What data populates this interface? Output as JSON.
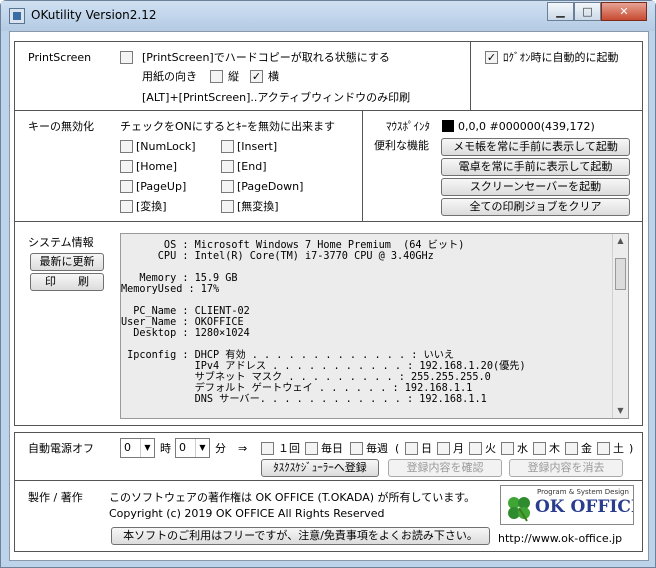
{
  "window": {
    "title": "OKutility Version2.12",
    "minimize": "▁",
    "maximize": "□",
    "close": "✕"
  },
  "print": {
    "group_label": "PrintScreen",
    "hardcopy_label": "[PrintScreen]でハードコピーが取れる状態にする",
    "paper_label": "用紙の向き",
    "portrait_label": "縦",
    "landscape_label": "横",
    "landscape_check": "✓",
    "alt_label": "[ALT]+[PrintScreen]..アクティブウィンドウのみ印刷",
    "logon_label": "ﾛｸﾞｵﾝ時に自動的に起動",
    "logon_check": "✓"
  },
  "keys": {
    "group_label": "キーの無効化",
    "instruction": "チェックをONにするとｷｰを無効に出来ます",
    "items": [
      "[NumLock]",
      "[Insert]",
      "[Home]",
      "[End]",
      "[PageUp]",
      "[PageDown]",
      "[変換]",
      "[無変換]"
    ]
  },
  "mouse": {
    "label": "ﾏｳｽﾎﾟｲﾝﾀ",
    "coords": "0,0,0 #000000(439,172)"
  },
  "tools": {
    "label": "便利な機能",
    "buttons": [
      "メモ帳を常に手前に表示して起動",
      "電卓を常に手前に表示して起動",
      "スクリーンセーバーを起動",
      "全ての印刷ジョブをクリア"
    ]
  },
  "system": {
    "label": "システム情報",
    "refresh_button": "最新に更新",
    "print_button": "印　　刷",
    "lines": [
      "       OS : Microsoft Windows 7 Home Premium  (64 ビット)",
      "      CPU : Intel(R) Core(TM) i7-3770 CPU @ 3.40GHz",
      "",
      "   Memory : 15.9 GB",
      "MemoryUsed : 17%",
      "",
      "  PC_Name : CLIENT-02",
      "User_Name : OKOFFICE",
      "  Desktop : 1280×1024",
      "",
      " Ipconfig : DHCP 有効 . . . . . . . . . . . . . : いいえ",
      "            IPv4 アドレス . . . . . . . . . . . : 192.168.1.20(優先)",
      "            サブネット マスク . . . . . . . . . : 255.255.255.0",
      "            デフォルト ゲートウェイ . . . . . . : 192.168.1.1",
      "            DNS サーバー. . . . . . . . . . . . : 192.168.1.1"
    ]
  },
  "power": {
    "label": "自動電源オフ",
    "hour_value": "0",
    "hour_unit": "時",
    "minute_value": "0",
    "minute_unit": "分",
    "arrow": "⇒",
    "options": [
      "１回",
      "毎日",
      "毎週"
    ],
    "paren_open": "(",
    "paren_close": ")",
    "days": [
      "日",
      "月",
      "火",
      "水",
      "木",
      "金",
      "土"
    ],
    "scheduler_button": "ﾀｽｸｽｹｼﾞｭｰﾗｰへ登録",
    "confirm_button": "登録内容を確認",
    "delete_button": "登録内容を消去"
  },
  "copyright": {
    "label": "製作 / 著作",
    "line1": "このソフトウェアの著作権は OK OFFICE (T.OKADA) が所有しています。",
    "line2": "Copyright (c) 2019 OK OFFICE All Rights Reserved",
    "notice_button": "本ソフトのご利用はフリーですが、注意/免責事項をよくお読み下さい。",
    "url": "http://www.ok-office.jp",
    "logo_top": "Program & System Design",
    "logo_text": "OK OFFICE"
  }
}
